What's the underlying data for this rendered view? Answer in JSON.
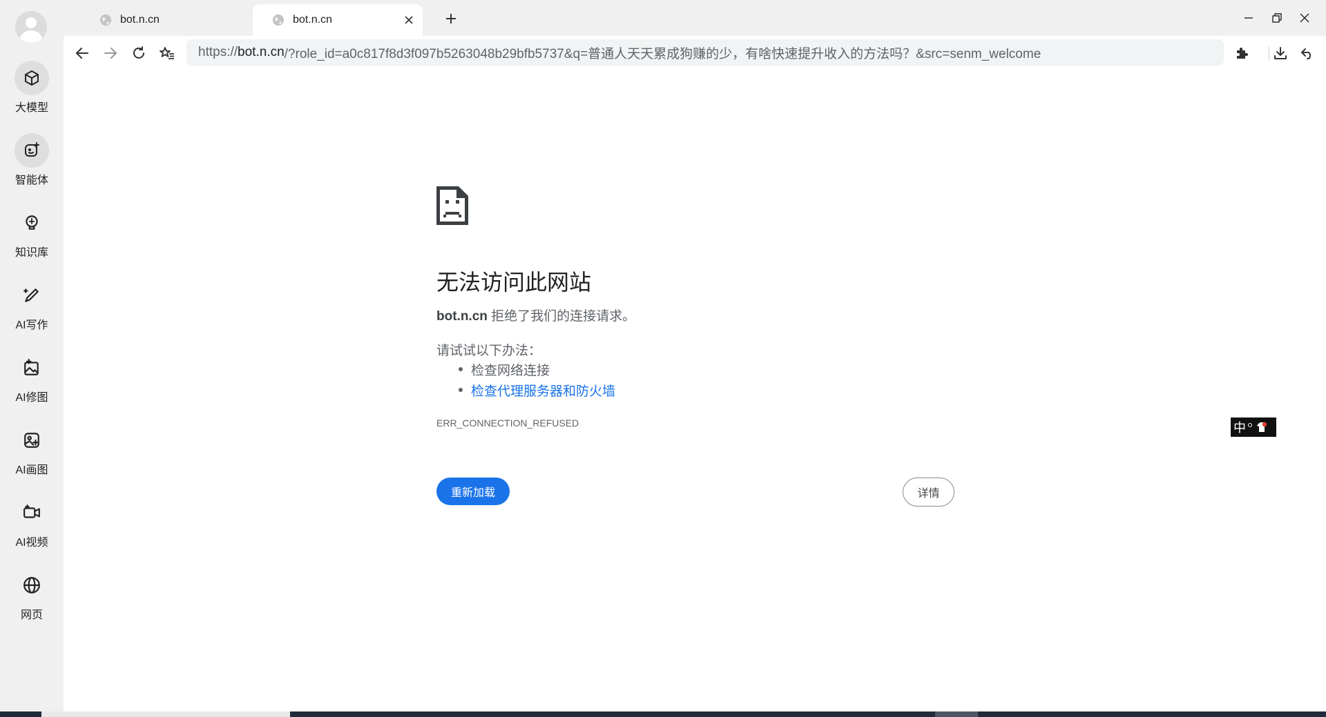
{
  "sidebar": {
    "items": [
      {
        "label": "大模型",
        "icon": "cube-icon"
      },
      {
        "label": "智能体",
        "icon": "agent-icon"
      },
      {
        "label": "知识库",
        "icon": "lightbulb-icon"
      },
      {
        "label": "AI写作",
        "icon": "pen-sparkle-icon"
      },
      {
        "label": "AI修图",
        "icon": "image-edit-icon"
      },
      {
        "label": "AI画图",
        "icon": "image-sparkle-icon"
      },
      {
        "label": "AI视频",
        "icon": "video-sparkle-icon"
      },
      {
        "label": "网页",
        "icon": "globe-icon"
      }
    ]
  },
  "tabs": [
    {
      "title": "bot.n.cn",
      "active": false
    },
    {
      "title": "bot.n.cn",
      "active": true
    }
  ],
  "address_bar": {
    "scheme": "https://",
    "host": "bot.n.cn",
    "rest": "/?role_id=a0c817f8d3f097b5263048b29bfb5737&q=普通人天天累成狗赚的少，有啥快速提升收入的方法吗？&src=senm_welcome"
  },
  "error_page": {
    "title": "无法访问此网站",
    "host": "bot.n.cn",
    "message": " 拒绝了我们的连接请求。",
    "try_label": "请试试以下办法：",
    "suggestions": [
      "检查网络连接",
      "检查代理服务器和防火墙"
    ],
    "error_code": "ERR_CONNECTION_REFUSED",
    "reload_label": "重新加载",
    "details_label": "详情"
  },
  "ime": {
    "label": "中"
  },
  "colors": {
    "accent": "#1a73e8",
    "sidebar_bg": "#f0f0f0",
    "tabbar_bg": "#f0f0f0"
  }
}
